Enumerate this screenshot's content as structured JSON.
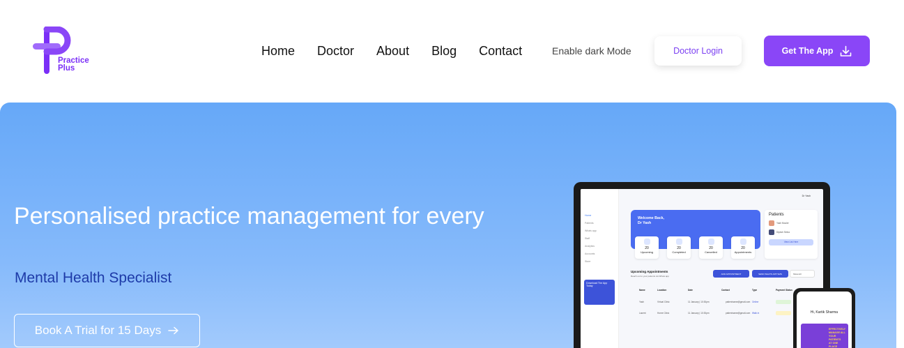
{
  "brand": {
    "line1": "Practice",
    "line2": "Plus"
  },
  "nav": {
    "items": [
      "Home",
      "Doctor",
      "About",
      "Blog",
      "Contact"
    ],
    "dark_mode_label": "Enable dark Mode",
    "doctor_login_label": "Doctor Login",
    "get_app_label": "Get The App"
  },
  "hero": {
    "title": "Personalised practice management for every",
    "subtitle": "Mental Health Specialist",
    "cta_label": "Book A Trial for 15 Days"
  },
  "mockup": {
    "doctor_name": "Dr Yash",
    "welcome_line1": "Welcome Back,",
    "welcome_line2": "Dr Yash",
    "sidebar": [
      "Home",
      "Patients",
      "Whats app",
      "Staff",
      "Analytics",
      "Accounts",
      "Store"
    ],
    "download_text": "Download The App Today",
    "stats": [
      {
        "value": "20",
        "label": "Upcoming"
      },
      {
        "value": "20",
        "label": "Completed"
      },
      {
        "value": "20",
        "label": "Cancelled"
      },
      {
        "value": "20",
        "label": "Appointments"
      }
    ],
    "patients_title": "Patients",
    "patients": [
      "Yash Mouler",
      "Dipesh Sinha"
    ],
    "patients_view": "View List Here",
    "appointments_title": "Upcoming Appointments",
    "appointments_sub": "Reach out to your patients via Whats app",
    "add_appointment": "ADD APPOINTMENT",
    "send_whatsapp": "SEND WHATS APP SMS",
    "filter_label": "Show All",
    "table_headers": [
      "Name",
      "Location",
      "Date",
      "Contact",
      "Type",
      "Payment Status"
    ],
    "table_rows": [
      {
        "name": "Yash",
        "location": "Virtual Clinic",
        "date": "11 January | 10:30pm",
        "contact": "patientname@gmail.com",
        "type": "Online"
      },
      {
        "name": "Lacent",
        "location": "Home Clinic",
        "date": "11 January | 10:30pm",
        "contact": "patientname@gmail.com",
        "type": "Walk in"
      }
    ]
  },
  "phone": {
    "greeting": "Hi, Kartik Sharma",
    "card_line1": "EFFECTIVELY",
    "card_line2": "MANAGE ALL YOUR",
    "card_line3": "PATIENTS",
    "card_line4": "AT ONE PLACE"
  },
  "colors": {
    "brand_purple": "#8a46f7",
    "hero_blue": "#66a8f8",
    "subtitle_blue": "#1d3aa8"
  }
}
